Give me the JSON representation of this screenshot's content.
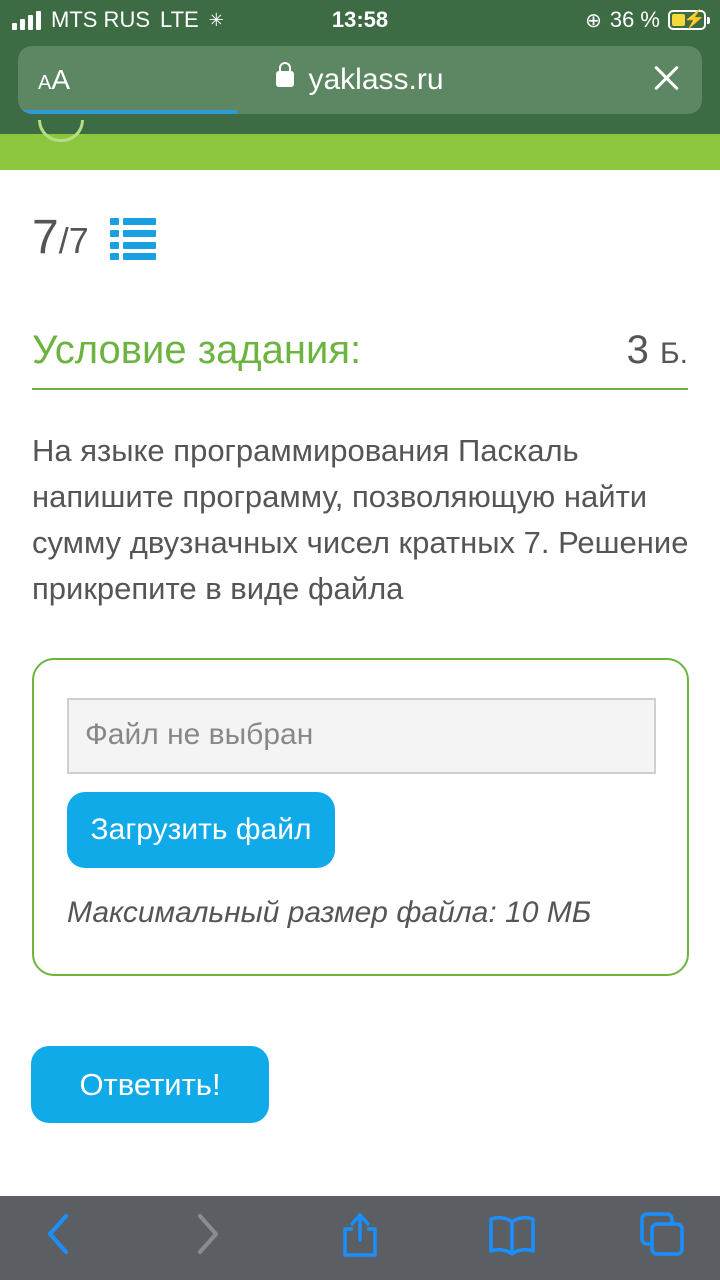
{
  "status_bar": {
    "carrier": "MTS RUS",
    "network": "LTE",
    "time": "13:58",
    "battery": "36 %"
  },
  "browser": {
    "text_size_label_small": "A",
    "text_size_label_large": "A",
    "url": "yaklass.ru",
    "load_progress": 0.32
  },
  "task": {
    "counter_current": "7",
    "counter_total": "/7",
    "condition_title": "Условие задания:",
    "points_value": "3",
    "points_unit": "Б.",
    "text": "На языке программирования Паскаль напишите программу, позволяющую найти сумму двузначных чисел кратных 7. Решение прикрепите в виде файла"
  },
  "upload": {
    "file_placeholder": "Файл не выбран",
    "upload_button": "Загрузить файл",
    "max_size": "Максимальный размер файла: 10 МБ"
  },
  "answer_button": "Ответить!",
  "colors": {
    "accent_green": "#6db33f",
    "header_green": "#8cc63f",
    "button_blue": "#11aae8",
    "toolbar_icon_blue": "#1a8fff"
  }
}
